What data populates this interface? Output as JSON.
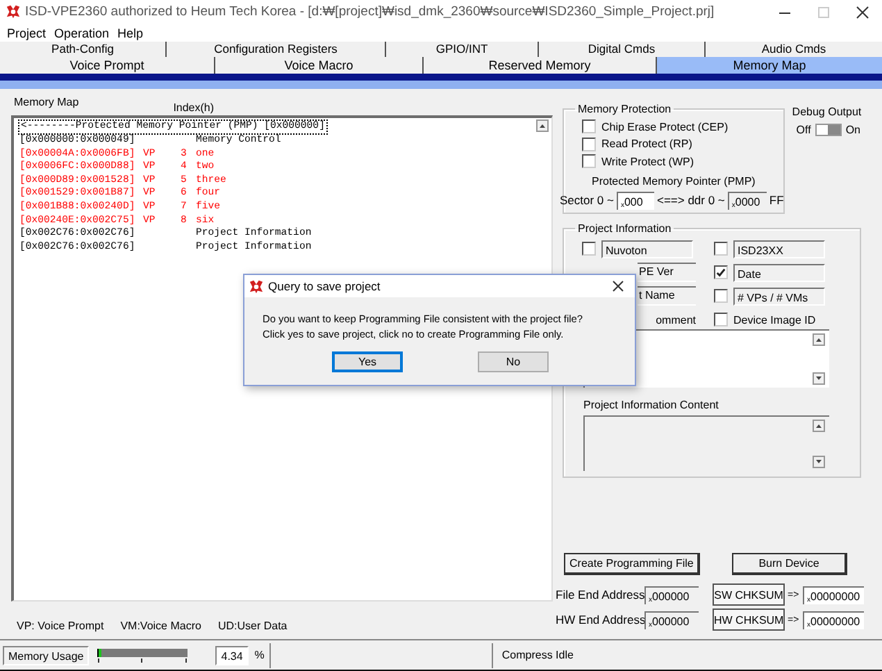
{
  "window": {
    "title": "ISD-VPE2360 authorized to Heum Tech Korea - [d:₩[project]₩isd_dmk_2360₩source₩ISD2360_Simple_Project.prj]"
  },
  "menu": [
    "Project",
    "Operation",
    "Help"
  ],
  "tab_rows": [
    [
      {
        "label": "Path-Config",
        "selected": false
      },
      {
        "label": "Configuration Registers",
        "selected": false
      },
      {
        "label": "GPIO/INT",
        "selected": false
      },
      {
        "label": "Digital Cmds",
        "selected": false
      },
      {
        "label": "Audio Cmds",
        "selected": false
      }
    ],
    [
      {
        "label": "Voice Prompt",
        "selected": false
      },
      {
        "label": "Voice Macro",
        "selected": false
      },
      {
        "label": "Reserved Memory",
        "selected": false
      },
      {
        "label": "Memory Map",
        "selected": true
      }
    ]
  ],
  "memory_map": {
    "label": "Memory Map",
    "index_header": "Index(h)",
    "pmp_line": {
      "text": "<--------Protected Memory Pointer (PMP) [0x000000]",
      "focused": true
    },
    "lines": [
      {
        "range": "[0x000000:0x000049]",
        "name": "Memory Control",
        "color": "#000000"
      },
      {
        "range": "[0x00004A:0x0006FB]",
        "type": "VP",
        "index": "3",
        "name": "one",
        "color": "#ff0000"
      },
      {
        "range": "[0x0006FC:0x000D88]",
        "type": "VP",
        "index": "4",
        "name": "two",
        "color": "#ff0000"
      },
      {
        "range": "[0x000D89:0x001528]",
        "type": "VP",
        "index": "5",
        "name": "three",
        "color": "#ff0000"
      },
      {
        "range": "[0x001529:0x001B87]",
        "type": "VP",
        "index": "6",
        "name": "four",
        "color": "#ff0000"
      },
      {
        "range": "[0x001B88:0x00240D]",
        "type": "VP",
        "index": "7",
        "name": "five",
        "color": "#ff0000"
      },
      {
        "range": "[0x00240E:0x002C75]",
        "type": "VP",
        "index": "8",
        "name": "six",
        "color": "#ff0000"
      },
      {
        "range": "[0x002C76:0x002C76]",
        "name": "Project Information",
        "color": "#000000"
      },
      {
        "range": "[0x002C76:0x002C76]",
        "name": "Project Information",
        "color": "#000000"
      }
    ]
  },
  "legend": [
    "VP: Voice Prompt",
    "VM:Voice Macro",
    "UD:User Data"
  ],
  "memory_protection": {
    "title": "Memory Protection",
    "options": [
      {
        "label": "Chip Erase Protect (CEP)",
        "checked": false
      },
      {
        "label": "Read Protect (RP)",
        "checked": false
      },
      {
        "label": "Write Protect (WP)",
        "checked": false
      }
    ],
    "pmp_label": "Protected Memory Pointer (PMP)",
    "sector_label": "Sector 0 ~",
    "sector_value": "$_{x}$000",
    "arrow_label": "<==> ddr 0 ~",
    "addr_value": "$_{x}$0000",
    "addr_suffix": "FF"
  },
  "debug_output": {
    "title": "Debug Output",
    "off_label": "Off",
    "on_label": "On",
    "on": true
  },
  "project_information": {
    "title": "Project Information",
    "left": [
      {
        "kind": "check",
        "checked": false,
        "value": "Nuvoton"
      },
      {
        "kind": "fragment",
        "value": "PE Ver"
      },
      {
        "kind": "fragment",
        "value": "t Name"
      },
      {
        "kind": "label",
        "text": "omment"
      }
    ],
    "right": [
      {
        "kind": "field",
        "checked": false,
        "value": "ISD23XX"
      },
      {
        "kind": "field",
        "checked": true,
        "value": "Date"
      },
      {
        "kind": "field",
        "checked": false,
        "value": "# VPs / # VMs"
      },
      {
        "kind": "option",
        "checked": false,
        "label": "Device Image ID"
      }
    ],
    "content_label": "Project Information Content"
  },
  "actions": [
    {
      "label": "Create Programming File"
    },
    {
      "label": "Burn Device"
    }
  ],
  "addresses": [
    {
      "label": "File End Address",
      "value": "$_{x}$000000",
      "button": "SW CHKSUM",
      "arrow": "=>",
      "checksum": "$_{x}$00000000"
    },
    {
      "label": "HW End Address",
      "value": "$_{x}$000000",
      "button": "HW CHKSUM",
      "arrow": "=>",
      "checksum": "$_{x}$00000000"
    }
  ],
  "status_bar": {
    "label": "Memory Usage",
    "level": 0.04,
    "percent_value": "4.34",
    "percent_sign": "%",
    "message": "Compress Idle"
  },
  "dialog": {
    "title": "Query to save project",
    "message": [
      "Do you want to keep Programming File consistent with the project file?",
      "Click yes to save project, click no to create Programming File only."
    ],
    "buttons": [
      {
        "label": "Yes",
        "selected": true
      },
      {
        "label": "No",
        "selected": false
      }
    ]
  }
}
